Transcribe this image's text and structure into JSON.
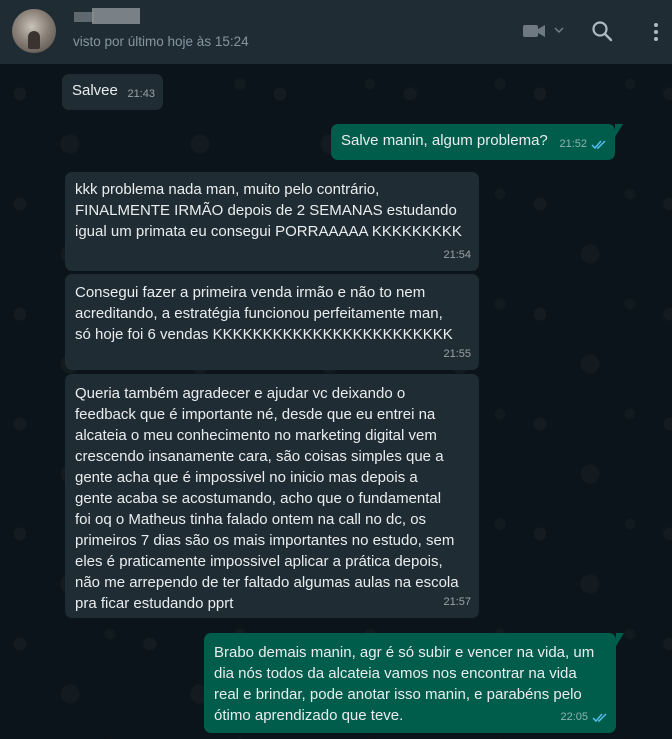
{
  "header": {
    "status": "visto por último hoje às 15:24",
    "icons": [
      "avatar",
      "video-call-icon",
      "chevron-down-icon",
      "search-icon",
      "menu-icon"
    ]
  },
  "messages": [
    {
      "direction": "in",
      "text": "Salvee",
      "time": "21:43"
    },
    {
      "direction": "out",
      "text": "Salve manin, algum problema?",
      "time": "21:52",
      "read": true
    },
    {
      "direction": "in",
      "text": "kkk problema nada man, muito pelo contrário,\nFINALMENTE IRMÃO depois de 2 SEMANAS estudando\nigual um primata eu consegui PORRAAAAA KKKKKKKKK",
      "time": "21:54"
    },
    {
      "direction": "in",
      "text": "Consegui fazer a primeira venda irmão e não to nem\nacreditando, a estratégia funcionou perfeitamente man,\nsó hoje foi 6 vendas KKKKKKKKKKKKKKKKKKKKKKKK",
      "time": "21:55"
    },
    {
      "direction": "in",
      "text": "Queria também agradecer e ajudar vc deixando o\nfeedback que é importante né, desde que eu entrei na\nalcateia o meu conhecimento no marketing digital vem\ncrescendo insanamente cara, são coisas simples que a\ngente acha que é impossivel no inicio mas depois a\ngente acaba se acostumando, acho que o fundamental\nfoi oq o Matheus tinha falado ontem na call no dc, os\nprimeiros 7 dias são os mais importantes no estudo, sem\neles é praticamente impossivel aplicar a prática depois,\nnão me arrependo de ter faltado algumas aulas na escola\npra ficar estudando pprt",
      "time": "21:57"
    },
    {
      "direction": "out",
      "text": "Brabo demais manin, agr é só subir e vencer na vida, um\ndia nós todos da alcateia vamos nos encontrar na vida\nreal e brindar, pode anotar isso manin, e parabéns pelo\nótimo aprendizado que teve.",
      "time": "22:05",
      "read": true
    }
  ],
  "colors": {
    "background": "#0b141a",
    "header": "#202c33",
    "incoming": "#202c33",
    "outgoing": "#005c4b",
    "read_check": "#53bdeb"
  }
}
